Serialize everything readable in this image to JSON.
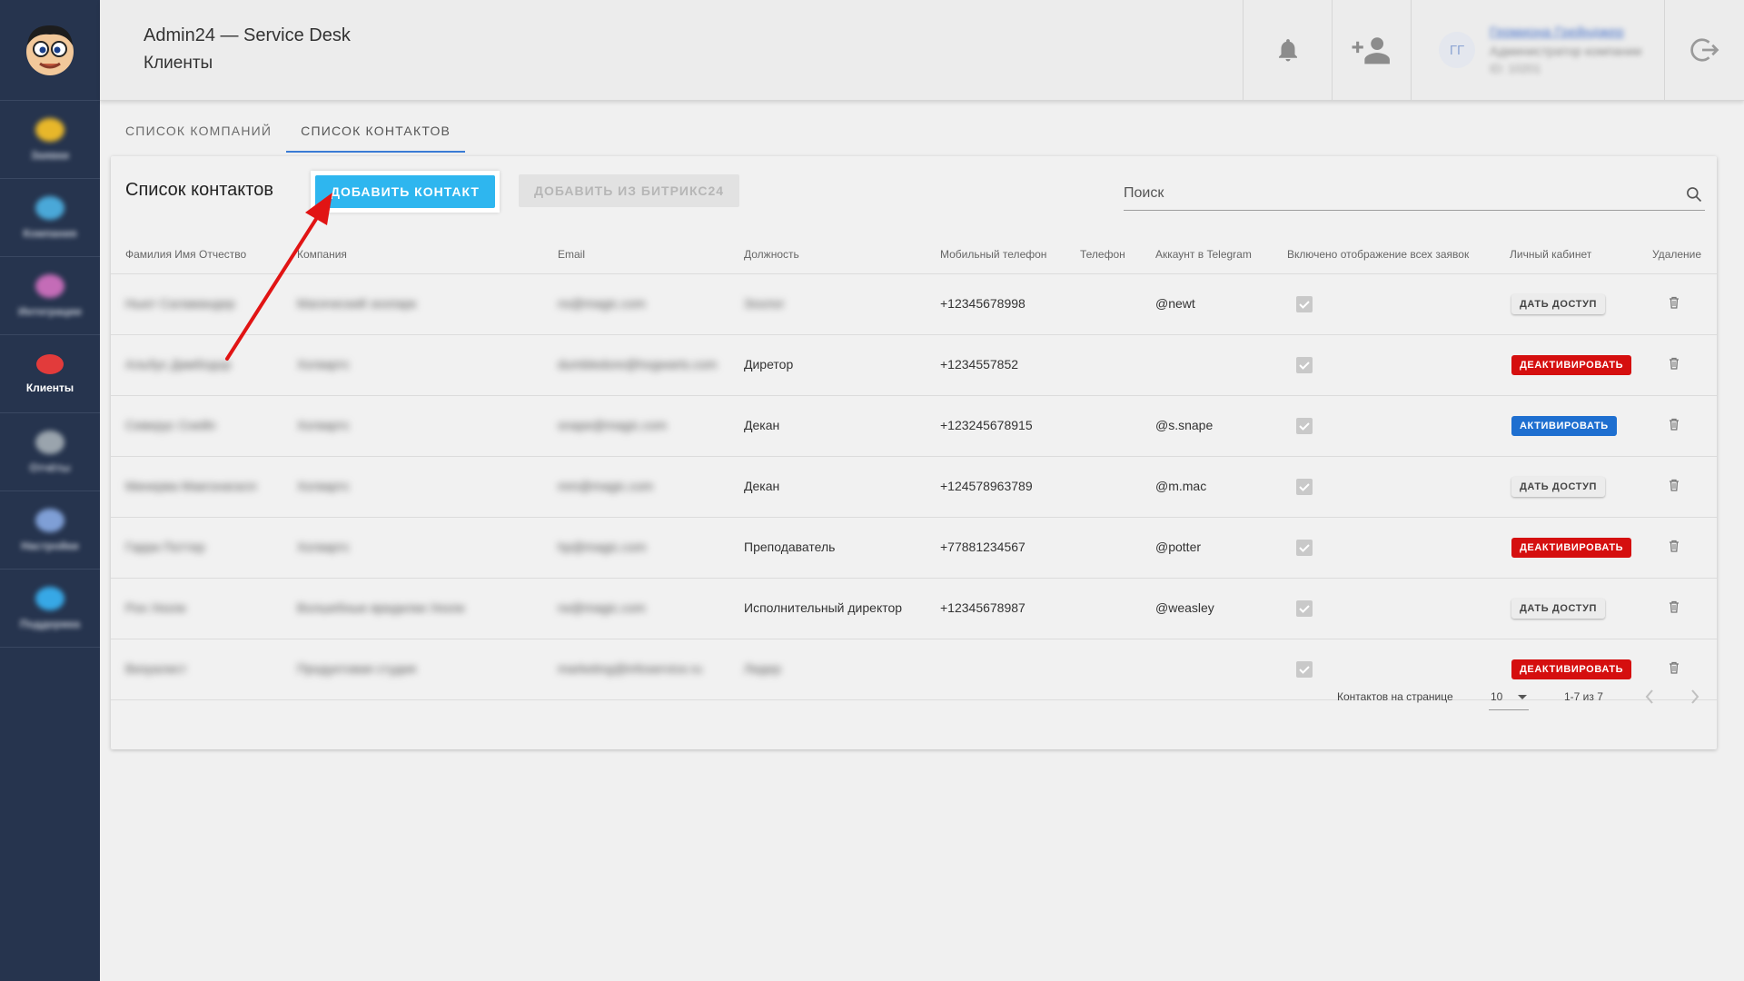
{
  "header": {
    "app_title": "Admin24 — Service Desk",
    "page_title": "Клиенты",
    "user": {
      "initials": "ГГ",
      "name": "Гермиона Грейнджер",
      "role": "Администратор компании",
      "id": "ID: 10201"
    }
  },
  "sidebar": {
    "items": [
      {
        "label": "Заявки",
        "active": false,
        "color": "#e8b72a"
      },
      {
        "label": "Компания",
        "active": false,
        "color": "#4aa8d8"
      },
      {
        "label": "Интеграции",
        "active": false,
        "color": "#c46cb7"
      },
      {
        "label": "Клиенты",
        "active": true,
        "color": "#e23b3b"
      },
      {
        "label": "Отчёты",
        "active": false,
        "color": "#9aa4ad"
      },
      {
        "label": "Настройки",
        "active": false,
        "color": "#7f9fd6"
      },
      {
        "label": "Поддержка",
        "active": false,
        "color": "#37a8e6"
      }
    ]
  },
  "tabs": [
    "СПИСОК КОМПАНИЙ",
    "СПИСОК КОНТАКТОВ"
  ],
  "active_tab": 1,
  "card": {
    "title": "Список контактов",
    "add_button": "ДОБАВИТЬ КОНТАКТ",
    "bitrix_button": "ДОБАВИТЬ ИЗ БИТРИКС24",
    "search_placeholder": "Поиск"
  },
  "columns": [
    "Фамилия Имя Отчество",
    "Компания",
    "Email",
    "Должность",
    "Мобильный телефон",
    "Телефон",
    "Аккаунт в Telegram",
    "Включено отображение всех заявок",
    "Личный кабинет",
    "Удаление"
  ],
  "rows": [
    {
      "name": "Ньют Саламандер",
      "company": "Магический зоопарк",
      "email": "ns@magic.com",
      "position": "Зоолог",
      "mobile": "+12345678998",
      "phone": "",
      "telegram": "@newt",
      "show_all": true,
      "cabinet": "ДАТЬ ДОСТУП",
      "cabinet_style": "gray"
    },
    {
      "name": "Альбус Дамблдор",
      "company": "Хогвартс",
      "email": "dumbledore@hogwarts.com",
      "position": "Диретор",
      "mobile": "+1234557852",
      "phone": "",
      "telegram": "",
      "show_all": true,
      "cabinet": "ДЕАКТИВИРОВАТЬ",
      "cabinet_style": "red"
    },
    {
      "name": "Северус Снейп",
      "company": "Хогвартс",
      "email": "snape@magic.com",
      "position": "Декан",
      "mobile": "+123245678915",
      "phone": "",
      "telegram": "@s.snape",
      "show_all": true,
      "cabinet": "АКТИВИРОВАТЬ",
      "cabinet_style": "blue"
    },
    {
      "name": "Минерва Макгонагалл",
      "company": "Хогвартс",
      "email": "mm@magic.com",
      "position": "Декан",
      "mobile": "+124578963789",
      "phone": "",
      "telegram": "@m.mac",
      "show_all": true,
      "cabinet": "ДАТЬ ДОСТУП",
      "cabinet_style": "gray"
    },
    {
      "name": "Гарри Поттер",
      "company": "Хогвартс",
      "email": "hp@magic.com",
      "position": "Преподаватель",
      "mobile": "+77881234567",
      "phone": "",
      "telegram": "@potter",
      "show_all": true,
      "cabinet": "ДЕАКТИВИРОВАТЬ",
      "cabinet_style": "red"
    },
    {
      "name": "Рон Уизли",
      "company": "Волшебные вредилки Уизли",
      "email": "rw@magic.com",
      "position": "Исполнительный директор",
      "mobile": "+12345678987",
      "phone": "",
      "telegram": "@weasley",
      "show_all": true,
      "cabinet": "ДАТЬ ДОСТУП",
      "cabinet_style": "gray"
    },
    {
      "name": "Визуалист",
      "company": "Продуктовая студия",
      "email": "marketing@infoservice.ru",
      "position": "Лидер",
      "mobile": "",
      "phone": "",
      "telegram": "",
      "show_all": true,
      "cabinet": "ДЕАКТИВИРОВАТЬ",
      "cabinet_style": "red"
    }
  ],
  "footer": {
    "per_page_label": "Контактов на странице",
    "per_page_value": "10",
    "range_text": "1-7 из 7"
  },
  "colors": {
    "sidebar_bg": "#26344e",
    "accent_blue": "#2eb6ef",
    "deactivate_red": "#d50f0f",
    "activate_blue": "#1e6fd0",
    "arrow_red": "#e11414"
  }
}
